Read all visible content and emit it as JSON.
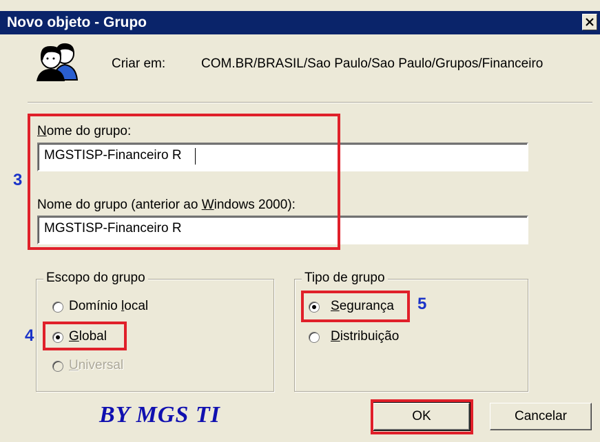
{
  "window": {
    "title": "Novo objeto - Grupo"
  },
  "header": {
    "icon": "group-users-icon",
    "create_in_label": "Criar em:",
    "create_in_path": "COM.BR/BRASIL/Sao Paulo/Sao Paulo/Grupos/Financeiro"
  },
  "group_name": {
    "label_first": "N",
    "label_rest": "ome do grupo:",
    "value": "MGSTISP-Financeiro R"
  },
  "group_name_pre2000": {
    "label_prefix": "Nome do grupo (anterior ao ",
    "label_accel": "W",
    "label_suffix": "indows 2000):",
    "value": "MGSTISP-Financeiro R"
  },
  "scope": {
    "legend": "Escopo do grupo",
    "options": [
      {
        "before": "Domínio ",
        "accel": "l",
        "after": "ocal",
        "selected": false,
        "enabled": true
      },
      {
        "before": "",
        "accel": "G",
        "after": "lobal",
        "selected": true,
        "enabled": true
      },
      {
        "before": "",
        "accel": "U",
        "after": "niversal",
        "selected": false,
        "enabled": false
      }
    ]
  },
  "type": {
    "legend": "Tipo de grupo",
    "options": [
      {
        "before": "",
        "accel": "S",
        "after": "egurança",
        "selected": true
      },
      {
        "before": "",
        "accel": "D",
        "after": "istribuição",
        "selected": false
      }
    ]
  },
  "buttons": {
    "ok": "OK",
    "cancel": "Cancelar"
  },
  "annotations": {
    "n3": "3",
    "n4": "4",
    "n5": "5",
    "watermark": "BY MGS TI",
    "highlight_color": "#e0202a",
    "number_color": "#1a33c8"
  }
}
